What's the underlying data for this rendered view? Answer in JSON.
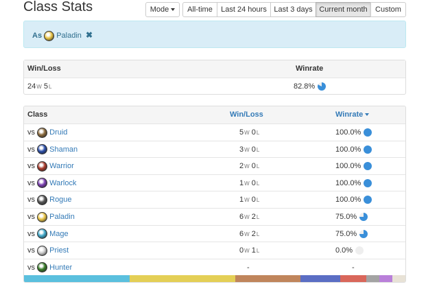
{
  "header": {
    "title": "Class Stats",
    "mode_label": "Mode",
    "ranges": [
      "All-time",
      "Last 24 hours",
      "Last 3 days",
      "Current month",
      "Custom"
    ],
    "active_range": "Current month"
  },
  "filter": {
    "prefix": "As",
    "class_name": "Paladin",
    "class_icon": "paladin-icon",
    "remove_icon": "close-icon"
  },
  "summary": {
    "headers": {
      "winloss": "Win/Loss",
      "winrate": "Winrate"
    },
    "wins": "24",
    "losses": "5",
    "win_unit": "W",
    "loss_unit": "L",
    "winrate": "82.8%",
    "winrate_fraction": 0.828
  },
  "table": {
    "headers": {
      "class": "Class",
      "winloss": "Win/Loss",
      "winrate": "Winrate"
    },
    "vs_label": "vs",
    "rows": [
      {
        "class": "Druid",
        "icon": "druid-icon",
        "wins": "5",
        "losses": "0",
        "winrate": "100.0%",
        "fraction": 1.0
      },
      {
        "class": "Shaman",
        "icon": "shaman-icon",
        "wins": "3",
        "losses": "0",
        "winrate": "100.0%",
        "fraction": 1.0
      },
      {
        "class": "Warrior",
        "icon": "warrior-icon",
        "wins": "2",
        "losses": "0",
        "winrate": "100.0%",
        "fraction": 1.0
      },
      {
        "class": "Warlock",
        "icon": "warlock-icon",
        "wins": "1",
        "losses": "0",
        "winrate": "100.0%",
        "fraction": 1.0
      },
      {
        "class": "Rogue",
        "icon": "rogue-icon",
        "wins": "1",
        "losses": "0",
        "winrate": "100.0%",
        "fraction": 1.0
      },
      {
        "class": "Paladin",
        "icon": "paladin-icon",
        "wins": "6",
        "losses": "2",
        "winrate": "75.0%",
        "fraction": 0.75
      },
      {
        "class": "Mage",
        "icon": "mage-icon",
        "wins": "6",
        "losses": "2",
        "winrate": "75.0%",
        "fraction": 0.75
      },
      {
        "class": "Priest",
        "icon": "priest-icon",
        "wins": "0",
        "losses": "1",
        "winrate": "0.0%",
        "fraction": 0.0
      },
      {
        "class": "Hunter",
        "icon": "hunter-icon",
        "wins": "",
        "losses": "",
        "winrate": "-",
        "fraction": null,
        "winloss_text": "-"
      }
    ]
  },
  "distribution": [
    {
      "color": "#5bc0de",
      "share": 0.277
    },
    {
      "color": "#e4cf56",
      "share": 0.277
    },
    {
      "color": "#c0855c",
      "share": 0.17
    },
    {
      "color": "#5b6ec4",
      "share": 0.106
    },
    {
      "color": "#d9675b",
      "share": 0.068
    },
    {
      "color": "#a3a3a3",
      "share": 0.034
    },
    {
      "color": "#b97fd9",
      "share": 0.034
    },
    {
      "color": "#e8e2d6",
      "share": 0.034
    }
  ],
  "colors": {
    "pie_fill": "#3a8fd9",
    "pie_empty": "#eeeeee",
    "link": "#337ab7"
  },
  "icon_colors": {
    "druid-icon": "#8a6a3c",
    "shaman-icon": "#2b4ea8",
    "warrior-icon": "#a83a2b",
    "warlock-icon": "#7a3fb0",
    "rogue-icon": "#555555",
    "paladin-icon": "#e8c447",
    "mage-icon": "#3fa7c9",
    "priest-icon": "#cccccc",
    "hunter-icon": "#3a7d2a"
  }
}
